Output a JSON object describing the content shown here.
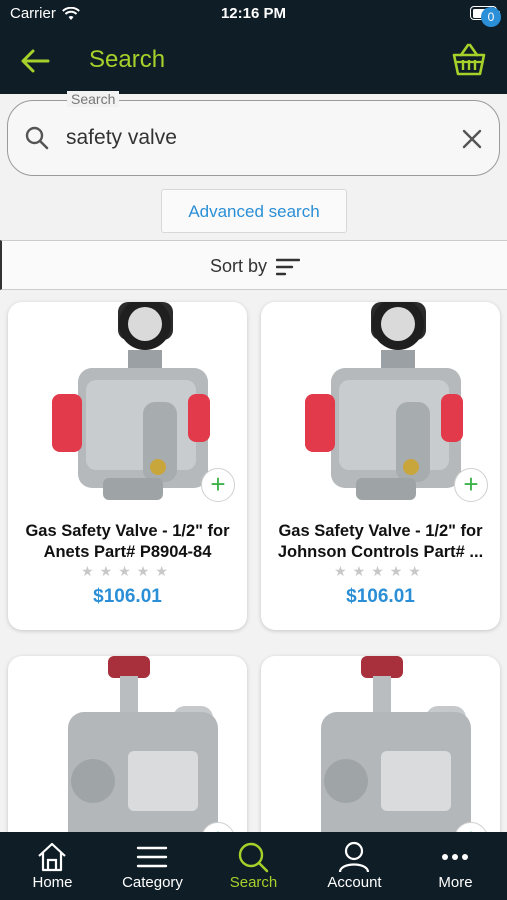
{
  "status_bar": {
    "carrier": "Carrier",
    "time": "12:16 PM"
  },
  "header": {
    "title": "Search",
    "cart_count": "0",
    "accent": "#a6d02a",
    "background": "#0f1d26"
  },
  "search": {
    "label": "Search",
    "value": "safety valve"
  },
  "advanced_search_label": "Advanced search",
  "sort_label": "Sort by",
  "products": [
    {
      "name": "Gas Safety Valve - 1/2\" for Anets Part# P8904-84",
      "price": "$106.01",
      "rating": 0
    },
    {
      "name": "Gas Safety Valve - 1/2\" for Johnson Controls Part# ...",
      "price": "$106.01",
      "rating": 0
    },
    {
      "name": "",
      "price": ""
    },
    {
      "name": "",
      "price": ""
    }
  ],
  "tabs": [
    {
      "label": "Home",
      "icon": "home-icon"
    },
    {
      "label": "Category",
      "icon": "menu-icon"
    },
    {
      "label": "Search",
      "icon": "search-icon",
      "active": true
    },
    {
      "label": "Account",
      "icon": "account-icon"
    },
    {
      "label": "More",
      "icon": "more-icon"
    }
  ]
}
